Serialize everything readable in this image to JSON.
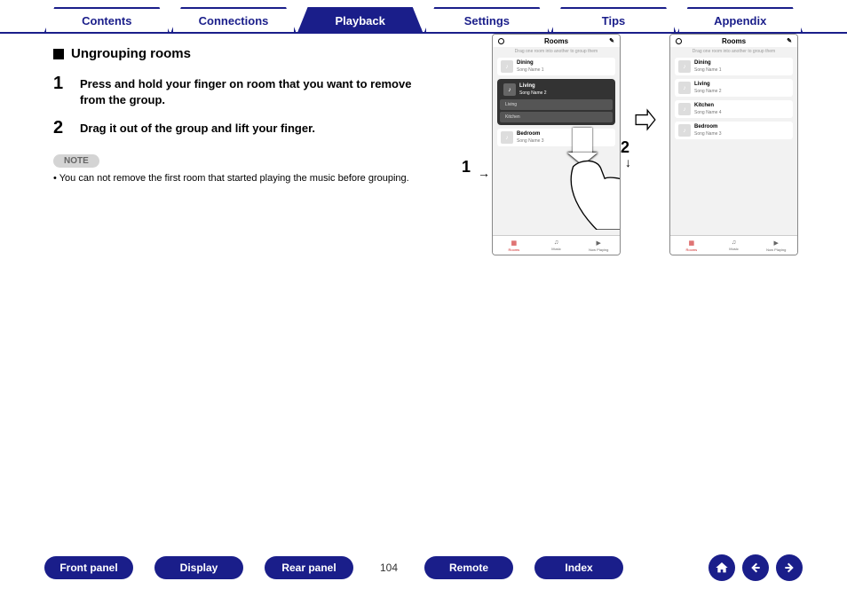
{
  "tabs": {
    "items": [
      "Contents",
      "Connections",
      "Playback",
      "Settings",
      "Tips",
      "Appendix"
    ],
    "active_index": 2
  },
  "section": {
    "title": "Ungrouping rooms"
  },
  "steps": [
    {
      "num": "1",
      "text": "Press and hold your finger on room that you want to remove from the group."
    },
    {
      "num": "2",
      "text": "Drag it out of the group and lift your finger."
    }
  ],
  "note": {
    "badge": "NOTE",
    "text": "You can not remove the first room that started playing the music before grouping."
  },
  "callouts": {
    "one": "1",
    "two": "2"
  },
  "phone": {
    "header": "Rooms",
    "hint": "Drag one room into another to group them",
    "tabs": {
      "rooms": "Rooms",
      "music": "Music",
      "now": "Now Playing"
    },
    "left": {
      "dining": {
        "name": "Dining",
        "song": "Song Name 1"
      },
      "living": {
        "name": "Living",
        "song": "Song Name 2"
      },
      "sub1": "Living",
      "sub2": "Kitchen",
      "bedroom": {
        "name": "Bedroom",
        "song": "Song Name 3"
      }
    },
    "right": {
      "dining": {
        "name": "Dining",
        "song": "Song Name 1"
      },
      "living": {
        "name": "Living",
        "song": "Song Name 2"
      },
      "kitchen": {
        "name": "Kitchen",
        "song": "Song Name 4"
      },
      "bedroom": {
        "name": "Bedroom",
        "song": "Song Name 3"
      }
    }
  },
  "bottom_nav": {
    "front": "Front panel",
    "display": "Display",
    "rear": "Rear panel",
    "remote": "Remote",
    "index": "Index",
    "page": "104"
  }
}
